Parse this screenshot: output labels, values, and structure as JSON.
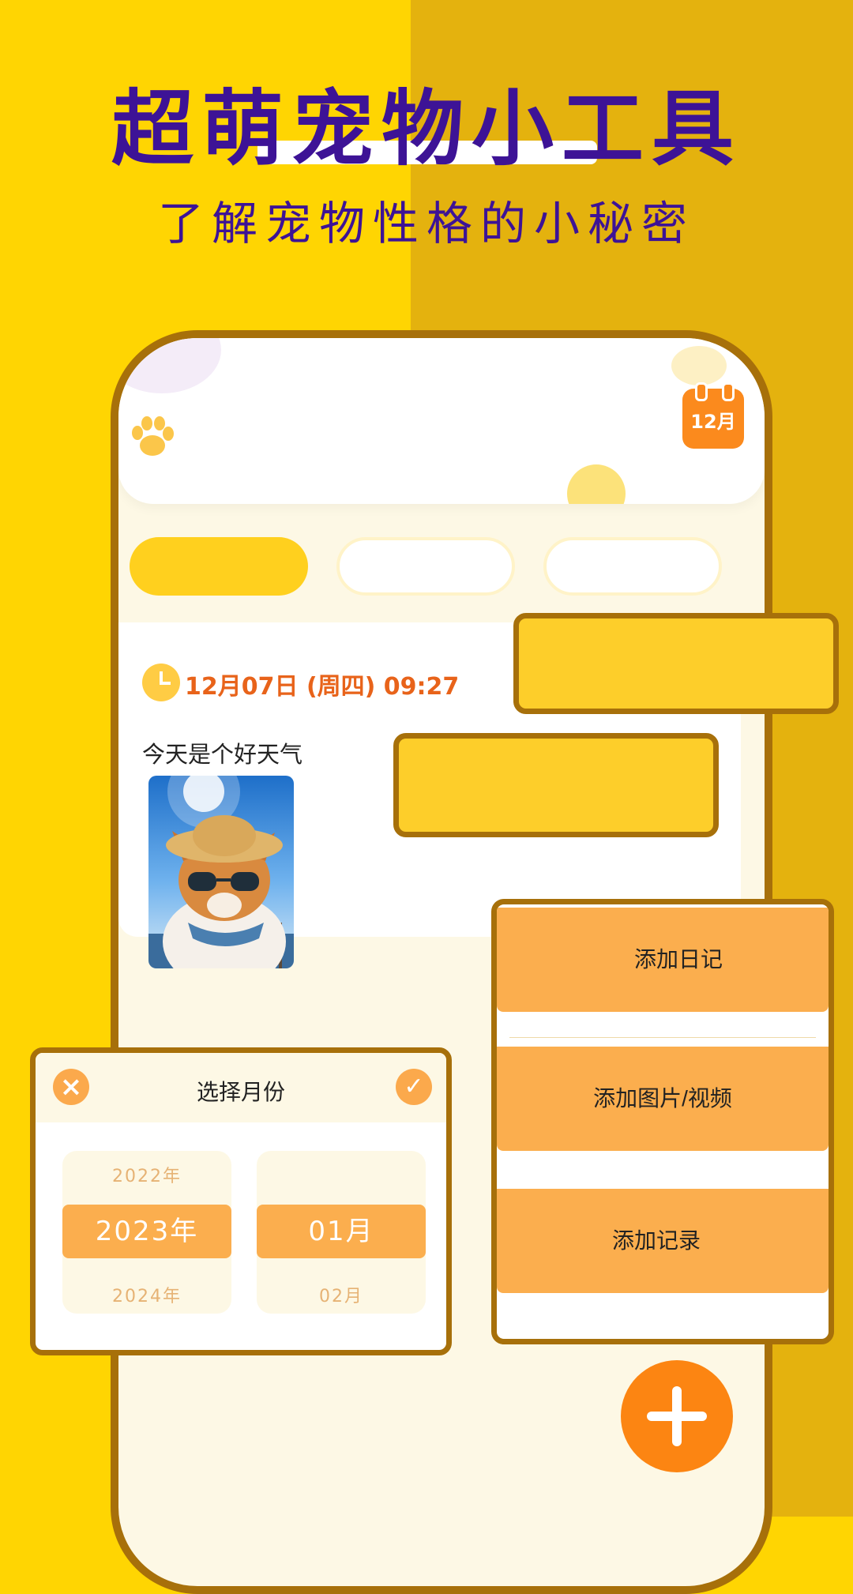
{
  "promo": {
    "headline": "超萌宠物小工具",
    "subheadline": "了解宠物性格的小秘密"
  },
  "app": {
    "calendar_badge": "12月",
    "entry": {
      "date": "12月07日 (周四) 09:27",
      "text": "今天是个好天气"
    },
    "month_picker": {
      "title": "选择月份",
      "years": [
        "2022年",
        "2023年",
        "2024年"
      ],
      "months": [
        "",
        "01月",
        "02月"
      ]
    },
    "add_menu": {
      "items": [
        "添加日记",
        "添加图片/视频",
        "添加记录"
      ]
    }
  },
  "colors": {
    "accent": "#FC8512",
    "title": "#3D1396",
    "frame": "#A7700A"
  }
}
